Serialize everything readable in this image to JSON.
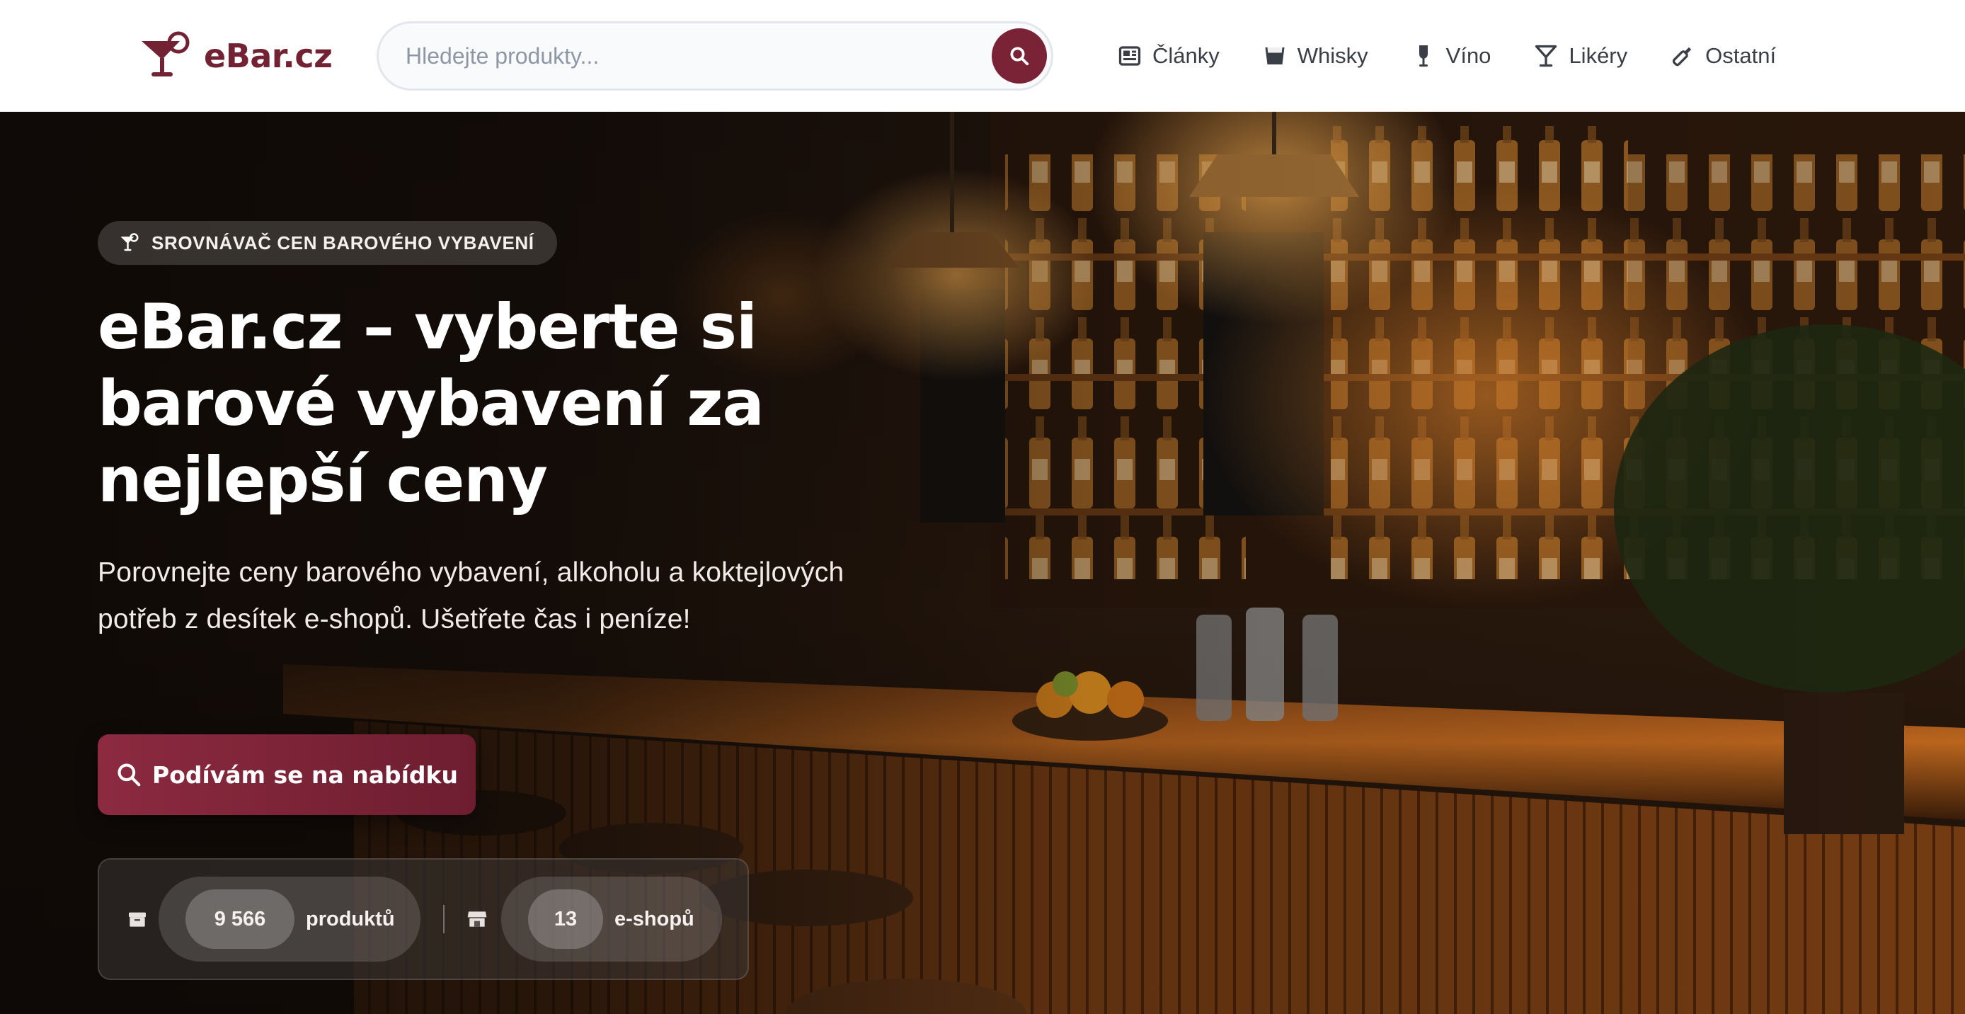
{
  "header": {
    "logo_text": "eBar.cz",
    "search_placeholder": "Hledejte produkty...",
    "nav": [
      {
        "label": "Články",
        "icon": "newspaper-icon"
      },
      {
        "label": "Whisky",
        "icon": "whisky-glass-icon"
      },
      {
        "label": "Víno",
        "icon": "wine-glass-icon"
      },
      {
        "label": "Likéry",
        "icon": "martini-glass-icon"
      },
      {
        "label": "Ostatní",
        "icon": "bottle-icon"
      }
    ]
  },
  "hero": {
    "badge": "SROVNÁVAČ CEN BAROVÉHO VYBAVENÍ",
    "title": "eBar.cz – vyberte si barové vybavení za nejlepší ceny",
    "subtitle": "Porovnejte ceny barového vybavení, alkoholu a koktejlových potřeb z desítek e-shopů. Ušetřete čas i peníze!",
    "cta_label": "Podívám se na nabídku",
    "stats": [
      {
        "value": "9 566",
        "label": "produktů",
        "icon": "box-icon"
      },
      {
        "value": "13",
        "label": "e-shopů",
        "icon": "store-icon"
      }
    ]
  },
  "colors": {
    "brand": "#722233",
    "brand_button": "#7a2336",
    "nav_text": "#3a3f47"
  }
}
